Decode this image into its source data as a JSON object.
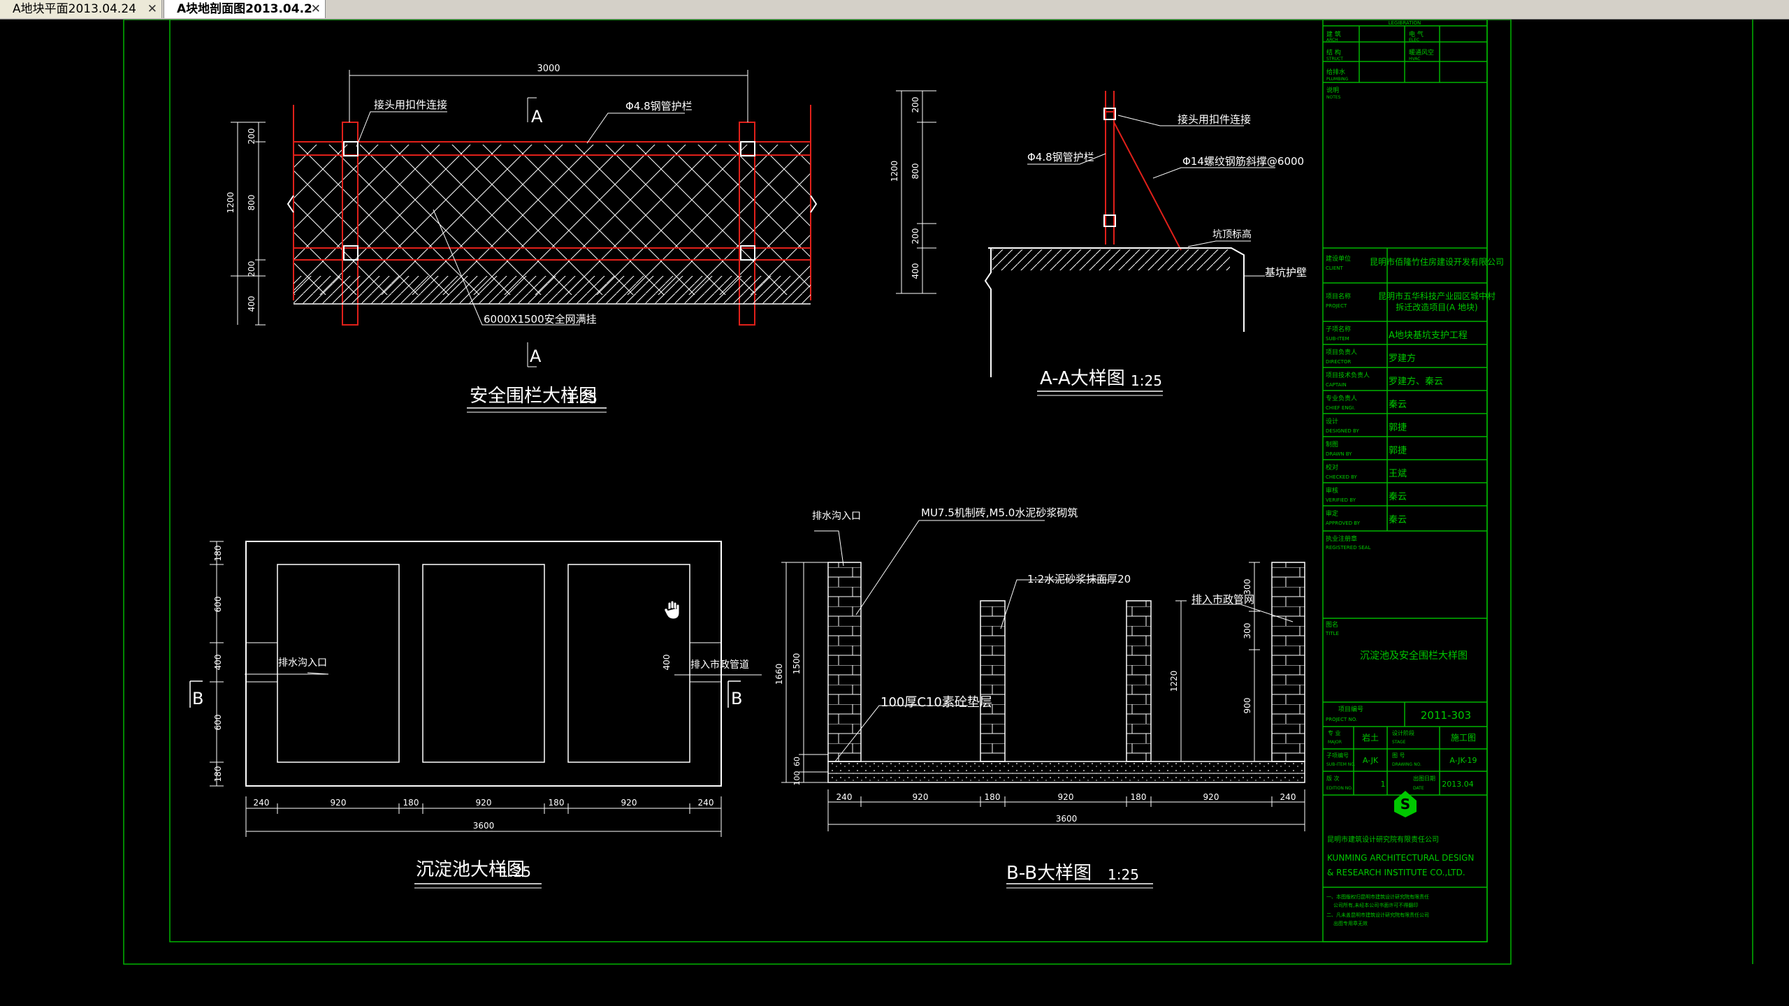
{
  "tabs": [
    {
      "label": "A地块平面2013.04.24",
      "close": "✕",
      "active": false
    },
    {
      "label": "A块地剖面图2013.04.2",
      "close": "✕",
      "active": true
    }
  ],
  "fence_elev": {
    "title": "安全围栏大样图",
    "scale": "1:25",
    "dim_top": "3000",
    "label_joint": "接头用扣件连接",
    "label_pipe": "Φ4.8钢管护栏",
    "label_net": "6000X1500安全网满挂",
    "section_mark": "A",
    "dims_v": [
      "200",
      "800",
      "200",
      "400"
    ],
    "dim_total": "1200"
  },
  "section_aa": {
    "title": "A-A大样图",
    "scale": "1:25",
    "label_joint": "接头用扣件连接",
    "label_pipe": "Φ4.8钢管护栏",
    "label_brace": "Φ14螺纹钢筋斜撑@6000",
    "label_top": "坑顶标高",
    "label_wall": "基坑护壁",
    "dims_v": [
      "200",
      "800",
      "200",
      "400"
    ],
    "dim_total": "1200"
  },
  "tank_plan": {
    "title": "沉淀池大样图",
    "scale": "1:25",
    "label_in": "排水沟入口",
    "label_out": "排入市政管道",
    "section_mark": "B",
    "inner_dim": "400",
    "dims_v": [
      "180",
      "600",
      "400",
      "600",
      "180"
    ],
    "dims_h": [
      "240",
      "920",
      "180",
      "920",
      "180",
      "920",
      "240"
    ],
    "dim_total": "3600"
  },
  "section_bb": {
    "title": "B-B大样图",
    "scale": "1:25",
    "label_in": "排水沟入口",
    "label_wall": "MU7.5机制砖,M5.0水泥砂浆砌筑",
    "label_plaster": "1:2水泥砂浆抹面厚20",
    "label_out": "排入市政管网",
    "label_base": "100厚C10素砼垫层",
    "dims_left": [
      "1500",
      "60",
      "100"
    ],
    "dim_left_total": "1660",
    "dim_mid": "1220",
    "dims_right": [
      "300",
      "300",
      "900"
    ],
    "dims_h": [
      "240",
      "920",
      "180",
      "920",
      "180",
      "920",
      "240"
    ],
    "dim_total": "3600"
  },
  "title_block": {
    "header": "LEGIBRATION",
    "sign_rows": [
      [
        "建 筑",
        "ARCH",
        "电 气",
        "ELEC"
      ],
      [
        "结 构",
        "STRUCT",
        "暖通风空",
        "HVAC"
      ],
      [
        "给排水",
        "PLUMBING",
        "",
        ""
      ]
    ],
    "notes_label": "说明",
    "notes_en": "NOTES",
    "rows": [
      {
        "cn": "建设单位",
        "en": "CLIENT",
        "val": "昆明市佰隆竹住房建设开发有限公司"
      },
      {
        "cn": "项目名称",
        "en": "PROJECT",
        "val": "昆明市五华科技产业园区城中村",
        "val2": "拆迁改造项目(A 地块)"
      },
      {
        "cn": "子项名称",
        "en": "SUB-ITEM",
        "val": "A地块基坑支护工程"
      },
      {
        "cn": "项目负责人",
        "en": "DIRECTOR",
        "val": "罗建方"
      },
      {
        "cn": "项目技术负责人",
        "en": "CAPTAIN",
        "val": "罗建方、秦云"
      },
      {
        "cn": "专业负责人",
        "en": "CHIEF ENGI.",
        "val": "秦云"
      },
      {
        "cn": "设计",
        "en": "DESIGNED BY",
        "val": "郭捷"
      },
      {
        "cn": "制图",
        "en": "DRAWN BY",
        "val": "郭捷"
      },
      {
        "cn": "校对",
        "en": "CHECKED BY",
        "val": "王斌"
      },
      {
        "cn": "审核",
        "en": "VERIFIED BY",
        "val": "秦云"
      },
      {
        "cn": "审定",
        "en": "APPROVED BY",
        "val": "秦云"
      }
    ],
    "seal_cn": "执业注册章",
    "seal_en": "REGISTERED SEAL",
    "title_cn": "图名",
    "title_en": "TITLE",
    "drawing_title": "沉淀池及安全围栏大样图",
    "project_no_label": "项目编号",
    "project_no_en": "PROJECT NO.",
    "project_no": "2011-303",
    "major_label": "专 业",
    "major_en": "MAJOR",
    "major": "岩土",
    "stage_label": "设计阶段",
    "stage_en": "STAGE",
    "stage": "施工图",
    "subitem_label": "子项编号",
    "subitem_en": "SUB-ITEM NO.",
    "subitem": "A-JK",
    "dwgno_label": "图 号",
    "dwgno_en": "DRAWING NO.",
    "dwgno": "A-JK-19",
    "edition_label": "版 次",
    "edition_en": "EDITION NO.",
    "edition": "1",
    "date_label": "出图日期",
    "date_en": "DATE",
    "date": "2013.04",
    "company_cn": "昆明市建筑设计研究院有限责任公司",
    "company_en1": "KUNMING ARCHITECTURAL DESIGN",
    "company_en2": "& RESEARCH INSTITUTE CO.,LTD.",
    "footnote1": "一、本图版权归昆明市建筑设计研究院有限责任",
    "footnote1b": "公司所有,未经本公司书面许可不得翻印",
    "footnote2": "二、凡未盖昆明市建筑设计研究院有限责任公司",
    "footnote2b": "出图专用章无效"
  },
  "colors": {
    "green": "#00c800",
    "red": "#e0201a",
    "white": "#ffffff",
    "cyan": "#00d0d0"
  }
}
